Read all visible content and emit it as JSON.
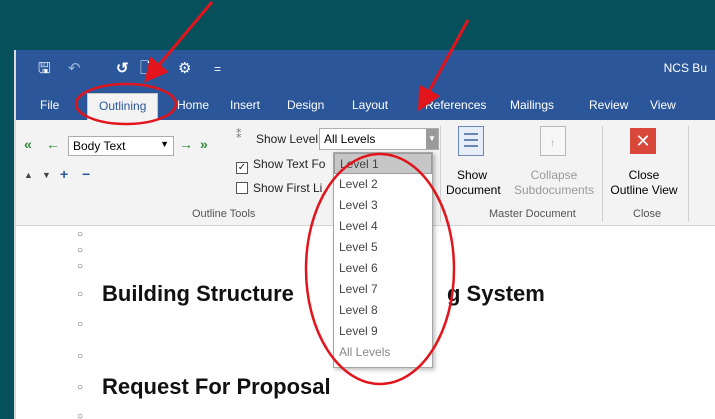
{
  "titlebar": {
    "doc_title": "NCS Bu",
    "qat": [
      {
        "icon": "save-icon",
        "glyph": "🖫"
      },
      {
        "icon": "undo-icon",
        "glyph": "↶"
      },
      {
        "icon": "redo-icon",
        "glyph": "↺"
      },
      {
        "icon": "print-preview-icon",
        "glyph": "🗋"
      },
      {
        "icon": "customize-icon",
        "glyph": "⚙"
      },
      {
        "icon": "more-icon",
        "glyph": "="
      }
    ]
  },
  "tabs": [
    {
      "label": "File"
    },
    {
      "label": "Outlining",
      "active": true
    },
    {
      "label": "Home"
    },
    {
      "label": "Insert"
    },
    {
      "label": "Design"
    },
    {
      "label": "Layout"
    },
    {
      "label": "References"
    },
    {
      "label": "Mailings"
    },
    {
      "label": "Review"
    },
    {
      "label": "View"
    }
  ],
  "ribbon": {
    "outline_tools": {
      "level_value": "Body Text",
      "show_level_label": "Show Level",
      "show_level_value": "All Levels",
      "show_text_formatting_label": "Show Text Fo",
      "show_text_formatting_checked": true,
      "show_first_line_label": "Show First Li",
      "show_first_line_checked": false,
      "group_label": "Outline Tools"
    },
    "master_document": {
      "show_document_line1": "Show",
      "show_document_line2": "Document",
      "collapse_line1": "Collapse",
      "collapse_line2": "Subdocuments",
      "group_label": "Master Document"
    },
    "close": {
      "close_line1": "Close",
      "close_line2": "Outline View",
      "group_label": "Close"
    }
  },
  "dropdown": {
    "items": [
      "Level 1",
      "Level 2",
      "Level 3",
      "Level 4",
      "Level 5",
      "Level 6",
      "Level 7",
      "Level 8",
      "Level 9",
      "All Levels"
    ],
    "highlighted": "Level 1"
  },
  "document": {
    "heading1": "Building Structure",
    "heading1_tail": "g System",
    "heading2": "Request For Proposal"
  },
  "colors": {
    "background": "#06505b",
    "ribbon_blue": "#2b579a",
    "annotation_red": "#e2141c",
    "close_red": "#d9463a"
  }
}
